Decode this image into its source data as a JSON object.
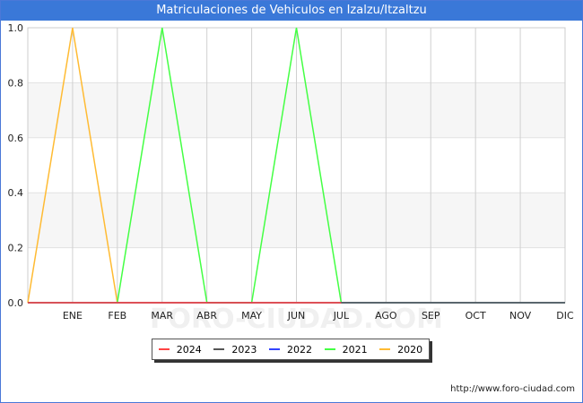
{
  "title": "Matriculaciones de Vehiculos en Izalzu/Itzaltzu",
  "footer": "http://www.foro-ciudad.com",
  "watermark": "FORO-CIUDAD.COM",
  "chart_data": {
    "type": "line",
    "title": "Matriculaciones de Vehiculos en Izalzu/Itzaltzu",
    "categories": [
      "",
      "ENE",
      "FEB",
      "MAR",
      "ABR",
      "MAY",
      "JUN",
      "JUL",
      "AGO",
      "SEP",
      "OCT",
      "NOV",
      "DIC"
    ],
    "ylim": [
      0,
      1.0
    ],
    "yticks": [
      "0.0",
      "0.2",
      "0.4",
      "0.6",
      "0.8",
      "1.0"
    ],
    "ytick_values": [
      0,
      0.2,
      0.4,
      0.6,
      0.8,
      1.0
    ],
    "grid": true,
    "legend_position": "bottom",
    "series": [
      {
        "name": "2024",
        "color": "#ff4444",
        "values": [
          0,
          0,
          0,
          0,
          0,
          0,
          0,
          0,
          null,
          null,
          null,
          null,
          null
        ]
      },
      {
        "name": "2023",
        "color": "#555555",
        "values": [
          0,
          0,
          0,
          0,
          0,
          0,
          0,
          0,
          0,
          0,
          0,
          0,
          0
        ]
      },
      {
        "name": "2022",
        "color": "#3344ff",
        "values": [
          0,
          0,
          0,
          0,
          0,
          0,
          0,
          0,
          0,
          0,
          0,
          0,
          0
        ]
      },
      {
        "name": "2021",
        "color": "#44ff44",
        "values": [
          0,
          0,
          0,
          1,
          0,
          0,
          1,
          0,
          0,
          0,
          0,
          0,
          0
        ]
      },
      {
        "name": "2020",
        "color": "#ffbb33",
        "values": [
          0,
          1,
          0,
          0,
          0,
          0,
          0,
          0,
          0,
          0,
          0,
          0,
          0
        ]
      }
    ]
  }
}
